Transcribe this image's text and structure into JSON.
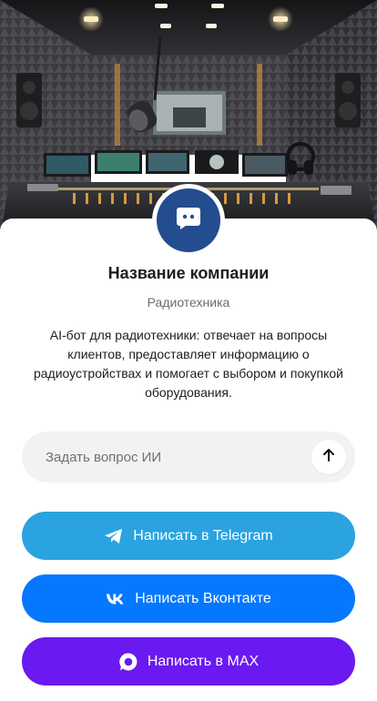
{
  "company": {
    "name": "Название компании",
    "category": "Радиотехника",
    "description": "AI-бот для радиотехники: отвечает на вопросы клиентов, предоставляет информацию о радиоустройствах и помогает с выбором и покупкой оборудования."
  },
  "ask": {
    "placeholder": "Задать вопрос ИИ"
  },
  "buttons": {
    "telegram": "Написать в Telegram",
    "vk": "Написать Вконтакте",
    "max": "Написать в MAX"
  },
  "colors": {
    "avatar_bg": "#234d8e",
    "telegram": "#2aa3e0",
    "vk": "#0677ff",
    "max": "#6a19f0",
    "input_bg": "#f2f2f3"
  },
  "icons": {
    "avatar": "chat-bot-icon",
    "send": "arrow-up-icon",
    "telegram": "telegram-icon",
    "vk": "vk-icon",
    "max": "max-icon"
  }
}
